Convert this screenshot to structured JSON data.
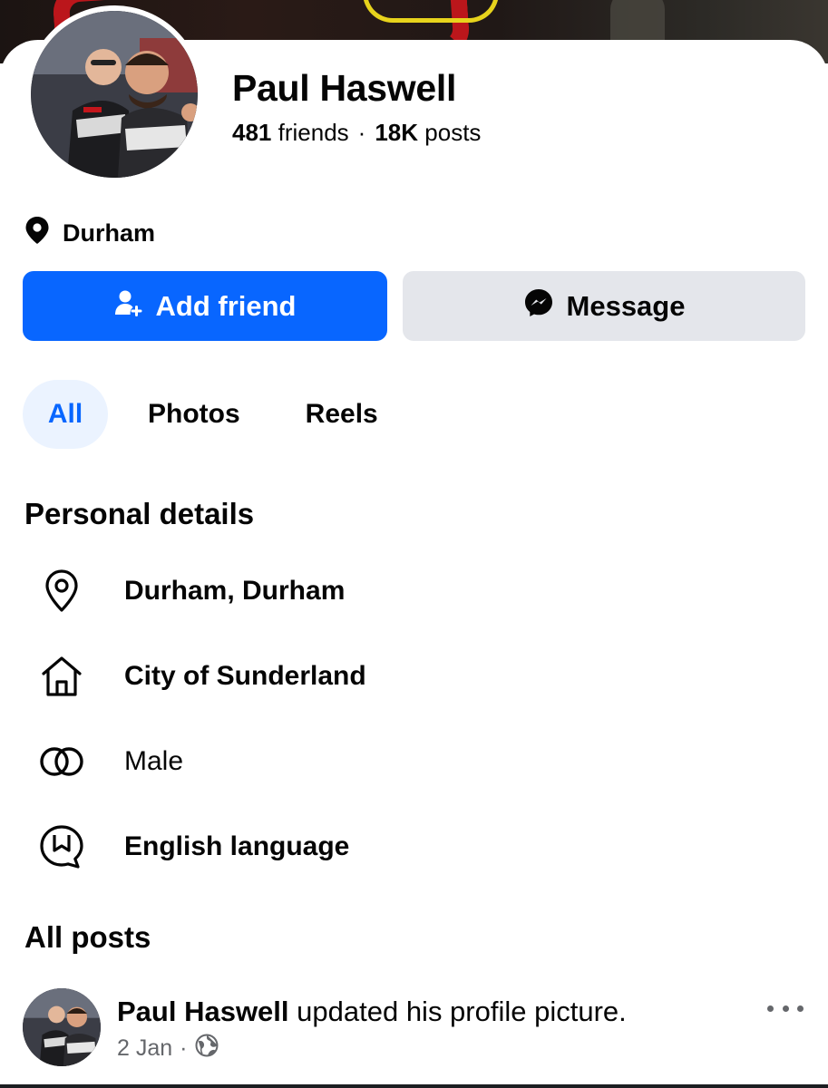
{
  "profile": {
    "name": "Paul Haswell",
    "friends_count": "481",
    "friends_label": "friends",
    "separator": "·",
    "posts_count": "18K",
    "posts_label": "posts"
  },
  "location": {
    "label": "Durham",
    "icon": "location-pin-icon"
  },
  "actions": {
    "add_friend_label": "Add friend",
    "add_friend_icon": "add-person-icon",
    "message_label": "Message",
    "message_icon": "messenger-icon"
  },
  "tabs": [
    {
      "label": "All",
      "active": true
    },
    {
      "label": "Photos",
      "active": false
    },
    {
      "label": "Reels",
      "active": false
    }
  ],
  "personal_details": {
    "title": "Personal details",
    "items": [
      {
        "icon": "location-pin-icon",
        "text": "Durham, Durham"
      },
      {
        "icon": "home-icon",
        "text": "City of Sunderland"
      },
      {
        "icon": "gender-icon",
        "text": "Male"
      },
      {
        "icon": "language-icon",
        "text": "English language"
      }
    ]
  },
  "posts": {
    "title": "All posts",
    "first": {
      "author": "Paul Haswell",
      "action": " updated his profile picture.",
      "date": "2 Jan",
      "separator": "·",
      "privacy_icon": "globe-icon",
      "more_icon": "more-options-icon"
    }
  },
  "colors": {
    "primary": "#0866ff",
    "secondary_button": "#e4e6eb",
    "active_tab_bg": "#ebf3ff",
    "muted_text": "#65676b"
  }
}
